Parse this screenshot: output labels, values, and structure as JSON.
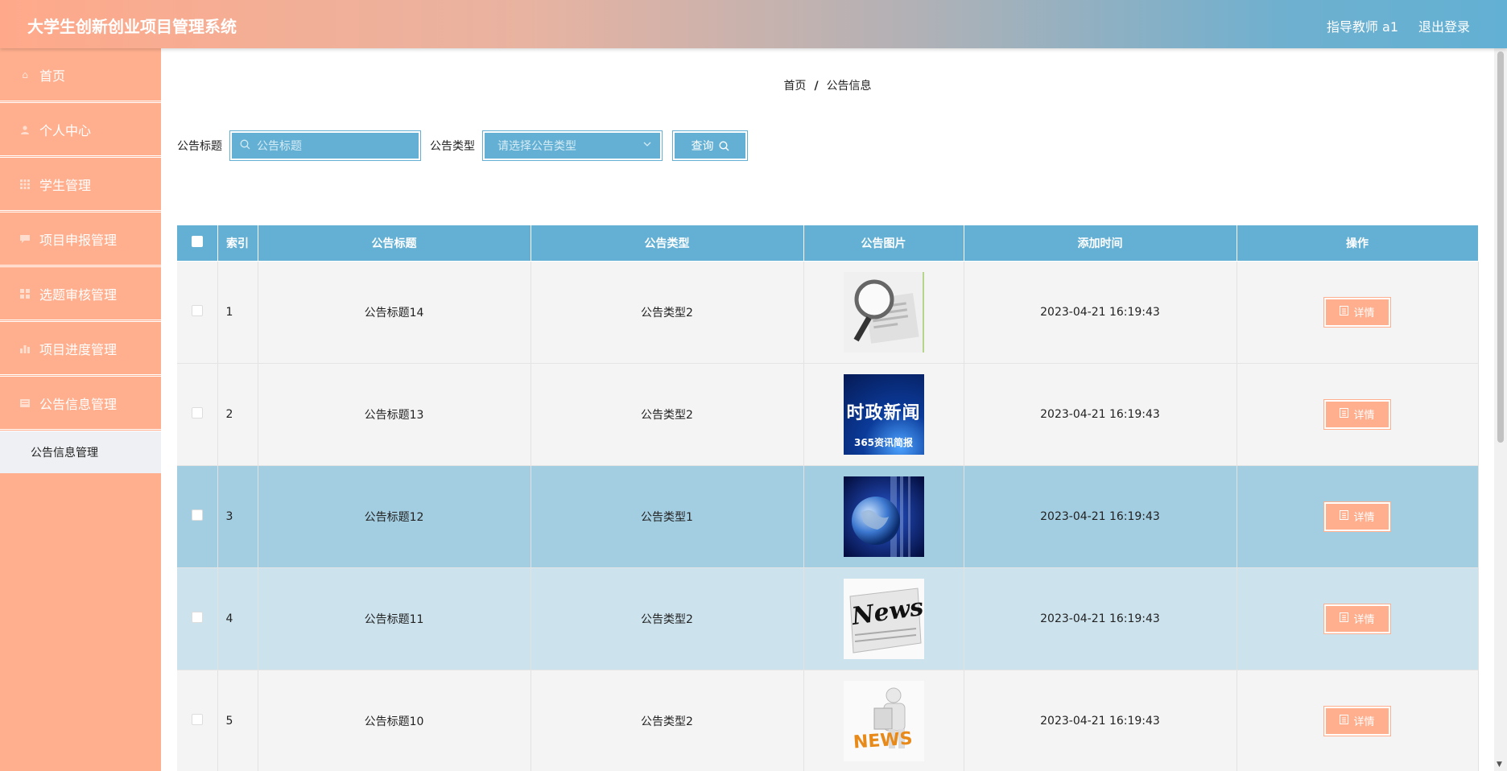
{
  "header": {
    "title": "大学生创新创业项目管理系统",
    "user": "指导教师 a1",
    "logout": "退出登录"
  },
  "sidebar": {
    "items": [
      {
        "label": "首页",
        "icon": "home-icon"
      },
      {
        "label": "个人中心",
        "icon": "user-icon"
      },
      {
        "label": "学生管理",
        "icon": "grid-icon"
      },
      {
        "label": "项目申报管理",
        "icon": "chat-icon"
      },
      {
        "label": "选题审核管理",
        "icon": "apps-icon"
      },
      {
        "label": "项目进度管理",
        "icon": "chart-icon"
      },
      {
        "label": "公告信息管理",
        "icon": "news-icon"
      }
    ],
    "submenu": {
      "label": "公告信息管理"
    }
  },
  "breadcrumb": {
    "home": "首页",
    "sep": "/",
    "current": "公告信息"
  },
  "search": {
    "title_label": "公告标题",
    "title_placeholder": "公告标题",
    "type_label": "公告类型",
    "type_placeholder": "请选择公告类型",
    "query_label": "查询"
  },
  "table": {
    "headers": [
      "索引",
      "公告标题",
      "公告类型",
      "公告图片",
      "添加时间",
      "操作"
    ],
    "detail_label": "详情",
    "rows": [
      {
        "index": "1",
        "title": "公告标题14",
        "type": "公告类型2",
        "image": "news-magnifier",
        "time": "2023-04-21 16:19:43"
      },
      {
        "index": "2",
        "title": "公告标题13",
        "type": "公告类型2",
        "image": "shizheng-news",
        "image_text_top": "时政新闻",
        "image_text_bottom": "365资讯简报",
        "time": "2023-04-21 16:19:43"
      },
      {
        "index": "3",
        "title": "公告标题12",
        "type": "公告类型1",
        "image": "globe-blue",
        "time": "2023-04-21 16:19:43"
      },
      {
        "index": "4",
        "title": "公告标题11",
        "type": "公告类型2",
        "image": "newspaper-news",
        "image_text": "News",
        "time": "2023-04-21 16:19:43"
      },
      {
        "index": "5",
        "title": "公告标题10",
        "type": "公告类型2",
        "image": "news-figure",
        "image_text": "NEWS",
        "time": "2023-04-21 16:19:43"
      }
    ]
  },
  "colors": {
    "accent_blue": "#64b0d4",
    "accent_peach": "#ffaf8e",
    "row_selected": "#a3cde1",
    "row_hover": "#cce3ee"
  }
}
